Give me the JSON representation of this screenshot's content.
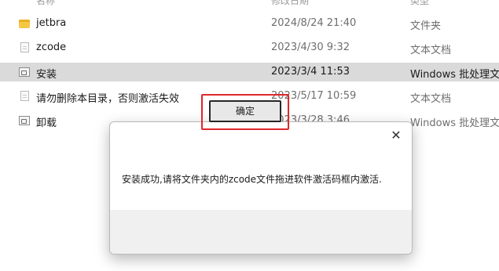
{
  "columns": {
    "name": "名称",
    "date": "修改日期",
    "type": "类型"
  },
  "files": [
    {
      "name": "jetbra",
      "date": "2024/8/24 21:40",
      "type": "文件夹",
      "icon": "folder-icon"
    },
    {
      "name": "zcode",
      "date": "2023/4/30 9:32",
      "type": "文本文档",
      "icon": "document-icon"
    },
    {
      "name": "安装",
      "date": "2023/3/4 11:53",
      "type": "Windows 批处理文",
      "icon": "batch-file-icon",
      "selected": true
    },
    {
      "name": "请勿删除本目录，否则激活失效",
      "date": "2023/5/17 10:59",
      "type": "文本文档",
      "icon": "document-icon"
    },
    {
      "name": "卸载",
      "date": "2023/3/28 3:46",
      "type": "Windows 批处理文",
      "icon": "batch-file-icon"
    }
  ],
  "dialog": {
    "close_label": "✕",
    "message": "安装成功,请将文件夹内的zcode文件拖进软件激活码框内激活.",
    "ok_label": "确定"
  },
  "colors": {
    "selected_row": "#dadada",
    "highlight": "#e0262b",
    "dialog_footer": "#f0f0f0"
  }
}
